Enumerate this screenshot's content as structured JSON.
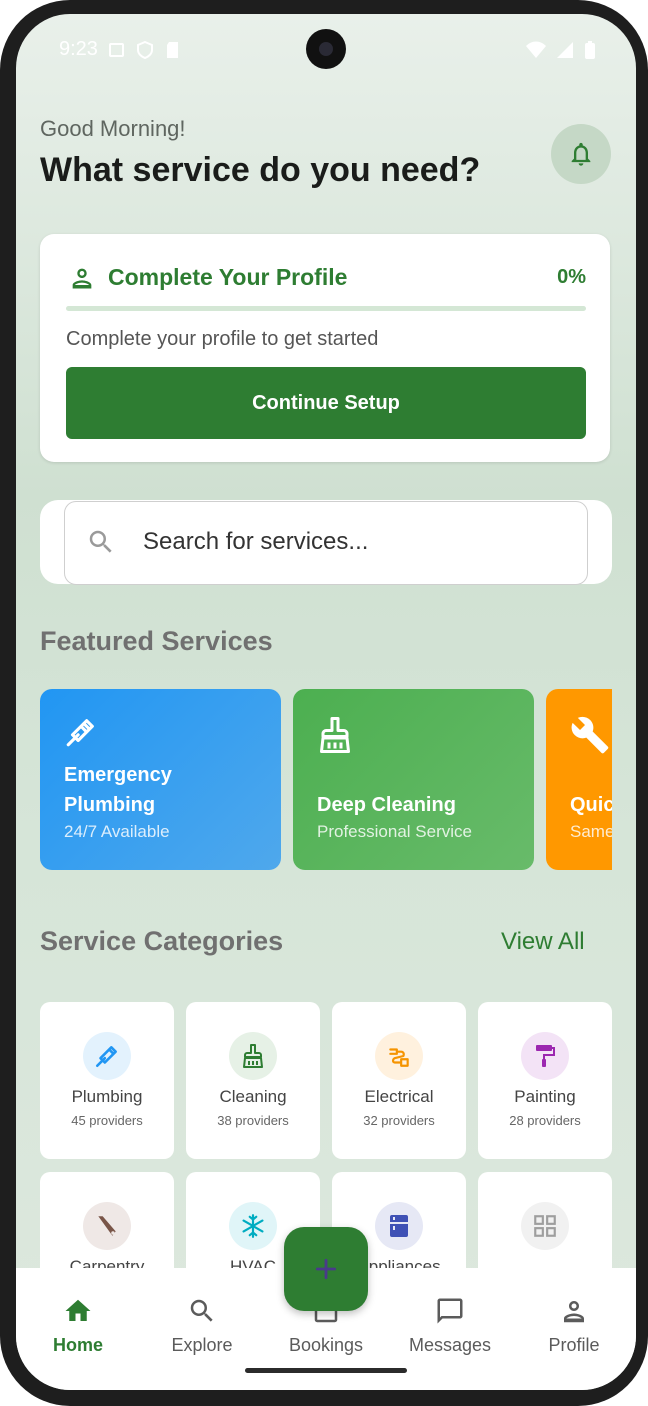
{
  "status_bar": {
    "time": "9:23"
  },
  "header": {
    "greeting": "Good Morning!",
    "headline": "What service do you need?"
  },
  "profile_card": {
    "title": "Complete Your Profile",
    "percent_label": "0%",
    "progress_fraction": 0,
    "subtitle": "Complete your profile to get started",
    "button_label": "Continue Setup"
  },
  "search": {
    "placeholder": "Search for services..."
  },
  "featured": {
    "title": "Featured Services",
    "items": [
      {
        "title_line1": "Emergency",
        "title_line2": "Plumbing",
        "subtitle": "24/7 Available",
        "icon": "pipe-wrench-icon",
        "color": "#2196f3"
      },
      {
        "title": "Deep Cleaning",
        "subtitle": "Professional Service",
        "icon": "broom-icon",
        "color": "#4caf50"
      },
      {
        "title": "Quic",
        "subtitle": "Same",
        "icon": "wrench-icon",
        "color": "#ff9800"
      }
    ]
  },
  "categories": {
    "title": "Service Categories",
    "view_all": "View All",
    "items": [
      {
        "name": "Plumbing",
        "providers": "45 providers",
        "icon": "pipe-wrench-icon",
        "color": "#2196f3",
        "bg": "#e3f2fd"
      },
      {
        "name": "Cleaning",
        "providers": "38 providers",
        "icon": "broom-icon",
        "color": "#2e7d32",
        "bg": "#e6f1e6"
      },
      {
        "name": "Electrical",
        "providers": "32 providers",
        "icon": "plug-icon",
        "color": "#f59400",
        "bg": "#fff1de"
      },
      {
        "name": "Painting",
        "providers": "28 providers",
        "icon": "paint-roller-icon",
        "color": "#9c27b0",
        "bg": "#f3e3f6"
      },
      {
        "name": "Carpentry",
        "providers": "",
        "icon": "saw-icon",
        "color": "#795548",
        "bg": "#efe8e6"
      },
      {
        "name": "HVAC",
        "providers": "",
        "icon": "snowflake-icon",
        "color": "#00acc1",
        "bg": "#e0f5f8"
      },
      {
        "name": "Appliances",
        "providers": "",
        "icon": "appliance-icon",
        "color": "#3f51b5",
        "bg": "#e6e8f5"
      },
      {
        "name": "",
        "providers": "",
        "icon": "grid-icon",
        "color": "#9e9e9e",
        "bg": "#f1f1f1"
      }
    ]
  },
  "bottom_nav": {
    "items": [
      {
        "label": "Home",
        "icon": "home-icon",
        "active": true
      },
      {
        "label": "Explore",
        "icon": "search-icon"
      },
      {
        "label": "Bookings",
        "icon": "calendar-icon"
      },
      {
        "label": "Messages",
        "icon": "chat-icon"
      },
      {
        "label": "Profile",
        "icon": "person-icon"
      }
    ]
  },
  "fab": {
    "icon": "plus-icon"
  },
  "colors": {
    "primary": "#2e7d32",
    "blue": "#2196f3",
    "green": "#4caf50",
    "orange": "#ff9800"
  }
}
